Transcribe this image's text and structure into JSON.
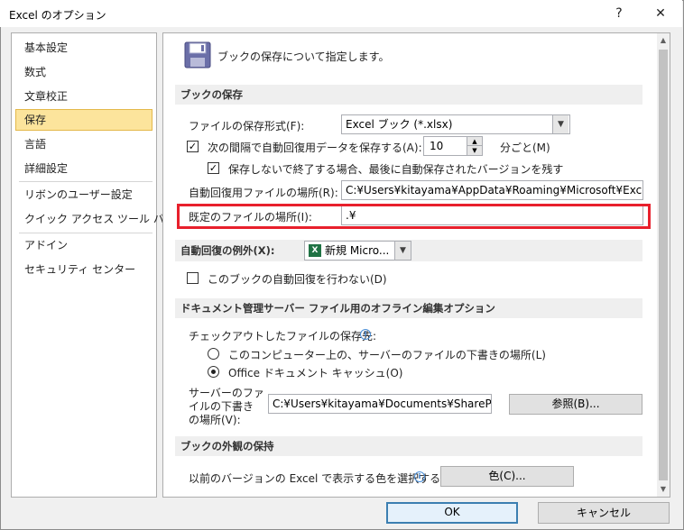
{
  "window": {
    "title": "Excel のオプション",
    "help": "?",
    "close": "✕"
  },
  "sidebar": {
    "items": [
      {
        "label": "基本設定"
      },
      {
        "label": "数式"
      },
      {
        "label": "文章校正"
      },
      {
        "label": "保存",
        "selected": true
      },
      {
        "label": "言語"
      },
      {
        "label": "詳細設定"
      },
      {
        "label": "リボンのユーザー設定"
      },
      {
        "label": "クイック アクセス ツール バー"
      },
      {
        "label": "アドイン"
      },
      {
        "label": "セキュリティ センター"
      }
    ]
  },
  "header": {
    "description": "ブックの保存について指定します。"
  },
  "save_section": {
    "title": "ブックの保存",
    "format_label": "ファイルの保存形式(F):",
    "format_value": "Excel ブック (*.xlsx)",
    "autorecover_label": "次の間隔で自動回復用データを保存する(A):",
    "autorecover_checked": true,
    "autorecover_minutes": "10",
    "minutes_unit": "分ごと(M)",
    "keep_last_label": "保存しないで終了する場合、最後に自動保存されたバージョンを残す",
    "keep_last_checked": true,
    "autorecover_location_label": "自動回復用ファイルの場所(R):",
    "autorecover_location_value": "C:¥Users¥kitayama¥AppData¥Roaming¥Microsoft¥Excel¥",
    "default_location_label": "既定のファイルの場所(I):",
    "default_location_value": ".¥"
  },
  "exceptions_section": {
    "title": "自動回復の例外(X):",
    "workbook_value": "新規 Micro...",
    "disable_label": "このブックの自動回復を行わない(D)",
    "disable_checked": false
  },
  "offline_section": {
    "title": "ドキュメント管理サーバー ファイル用のオフライン編集オプション",
    "checkout_label": "チェックアウトしたファイルの保存先:",
    "option_server": "このコンピューター上の、サーバーのファイルの下書きの場所(L)",
    "option_cache": "Office ドキュメント キャッシュ(O)",
    "selected": "cache",
    "drafts_label_1": "サーバーのファ",
    "drafts_label_2": "イルの下書き",
    "drafts_label_3": "の場所(V):",
    "drafts_value": "C:¥Users¥kitayama¥Documents¥SharePoint",
    "browse_button": "参照(B)..."
  },
  "visuals_section": {
    "title": "ブックの外観の保持",
    "colors_label": "以前のバージョンの Excel で表示する色を選択する:",
    "colors_button": "色(C)..."
  },
  "footer": {
    "ok": "OK",
    "cancel": "キャンセル"
  },
  "colors": {
    "selected_nav": "#fce49c",
    "highlight_border": "#e8202c",
    "excel_green": "#1f7244"
  }
}
